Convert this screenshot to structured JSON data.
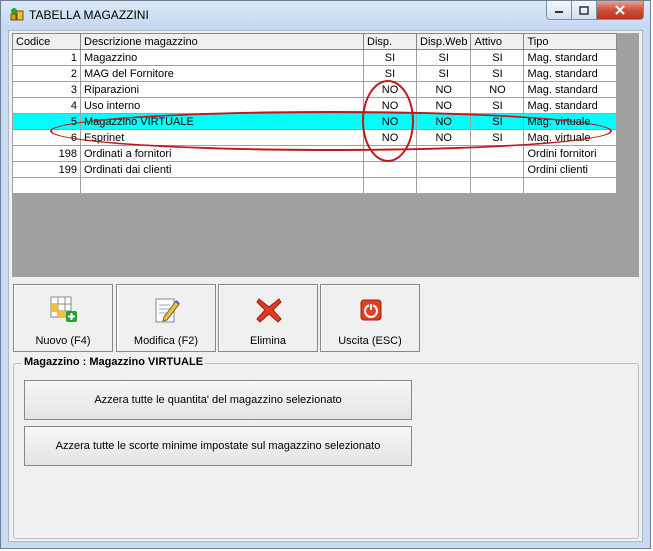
{
  "window": {
    "title": "TABELLA MAGAZZINI"
  },
  "grid": {
    "columns": [
      "Codice",
      "Descrizione magazzino",
      "Disp.",
      "Disp.Web",
      "Attivo",
      "Tipo"
    ],
    "rows": [
      {
        "codice": "1",
        "descrizione": "Magazzino",
        "disp": "SI",
        "disp_web": "SI",
        "attivo": "SI",
        "tipo": "Mag. standard"
      },
      {
        "codice": "2",
        "descrizione": "MAG del Fornitore",
        "disp": "SI",
        "disp_web": "SI",
        "attivo": "SI",
        "tipo": "Mag. standard"
      },
      {
        "codice": "3",
        "descrizione": "Riparazioni",
        "disp": "NO",
        "disp_web": "NO",
        "attivo": "NO",
        "tipo": "Mag. standard"
      },
      {
        "codice": "4",
        "descrizione": "Uso interno",
        "disp": "NO",
        "disp_web": "NO",
        "attivo": "SI",
        "tipo": "Mag. standard"
      },
      {
        "codice": "5",
        "descrizione": "Magazzino VIRTUALE",
        "disp": "NO",
        "disp_web": "NO",
        "attivo": "SI",
        "tipo": "Mag. virtuale"
      },
      {
        "codice": "6",
        "descrizione": "Esprinet",
        "disp": "NO",
        "disp_web": "NO",
        "attivo": "SI",
        "tipo": "Mag. virtuale"
      },
      {
        "codice": "198",
        "descrizione": "Ordinati a fornitori",
        "disp": "",
        "disp_web": "",
        "attivo": "",
        "tipo": "Ordini fornitori"
      },
      {
        "codice": "199",
        "descrizione": "Ordinati dai clienti",
        "disp": "",
        "disp_web": "",
        "attivo": "",
        "tipo": "Ordini clienti"
      }
    ],
    "selected_row": 4
  },
  "toolbar": {
    "new_label": "Nuovo (F4)",
    "edit_label": "Modifica (F2)",
    "delete_label": "Elimina",
    "exit_label": "Uscita (ESC)"
  },
  "group": {
    "title": "Magazzino : Magazzino VIRTUALE",
    "reset_qty_label": "Azzera tutte le quantita' del magazzino selezionato",
    "reset_min_label": "Azzera tutte le scorte minime impostate sul magazzino selezionato"
  },
  "icons": {
    "app": "warehouse-icon",
    "new": "grid-add-icon",
    "edit": "edit-document-icon",
    "delete": "red-x-icon",
    "exit": "power-icon"
  },
  "colors": {
    "selection": "#00ffff",
    "annotation": "#c0161d",
    "close_button": "#c9513b"
  }
}
